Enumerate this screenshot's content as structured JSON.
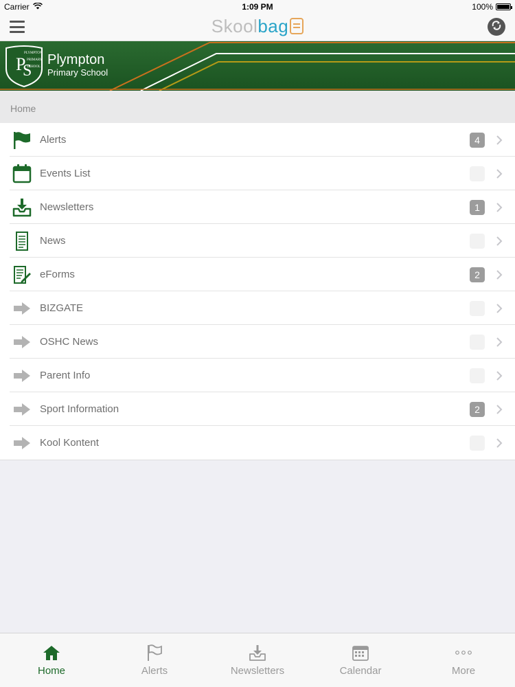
{
  "status_bar": {
    "carrier": "Carrier",
    "time": "1:09 PM",
    "battery": "100%",
    "battery_level": 1.0
  },
  "nav": {
    "logo_part1": "Skool",
    "logo_part2": "bag"
  },
  "banner": {
    "school_line1": "Plympton",
    "school_line2": "Primary School",
    "crest_text": [
      "PLYMPTON",
      "PRIMARY",
      "SCHOOL"
    ],
    "crest_initials": "PS"
  },
  "breadcrumb": "Home",
  "menu_items": [
    {
      "label": "Alerts",
      "badge": "4",
      "icon": "flag-icon"
    },
    {
      "label": "Events List",
      "badge": "0",
      "icon": "calendar-icon"
    },
    {
      "label": "Newsletters",
      "badge": "1",
      "icon": "inbox-download-icon"
    },
    {
      "label": "News",
      "badge": "0",
      "icon": "document-icon"
    },
    {
      "label": "eForms",
      "badge": "2",
      "icon": "form-pen-icon"
    },
    {
      "label": "BIZGATE",
      "badge": "0",
      "icon": "arrow-right-icon"
    },
    {
      "label": "OSHC News",
      "badge": "0",
      "icon": "arrow-right-icon"
    },
    {
      "label": "Parent Info",
      "badge": "0",
      "icon": "arrow-right-icon"
    },
    {
      "label": "Sport Information",
      "badge": "2",
      "icon": "arrow-right-icon"
    },
    {
      "label": "Kool Kontent",
      "badge": "0",
      "icon": "arrow-right-icon"
    }
  ],
  "tabs": [
    {
      "label": "Home",
      "icon": "home-icon",
      "active": true
    },
    {
      "label": "Alerts",
      "icon": "flag-icon",
      "active": false
    },
    {
      "label": "Newsletters",
      "icon": "inbox-download-icon",
      "active": false
    },
    {
      "label": "Calendar",
      "icon": "calendar-icon",
      "active": false
    },
    {
      "label": "More",
      "icon": "more-dots-icon",
      "active": false
    }
  ],
  "colors": {
    "brand_green": "#1d6a2a",
    "accent_orange": "#e6a65a",
    "logo_blue": "#2aa4c8",
    "badge_gray": "#9c9c9c"
  }
}
